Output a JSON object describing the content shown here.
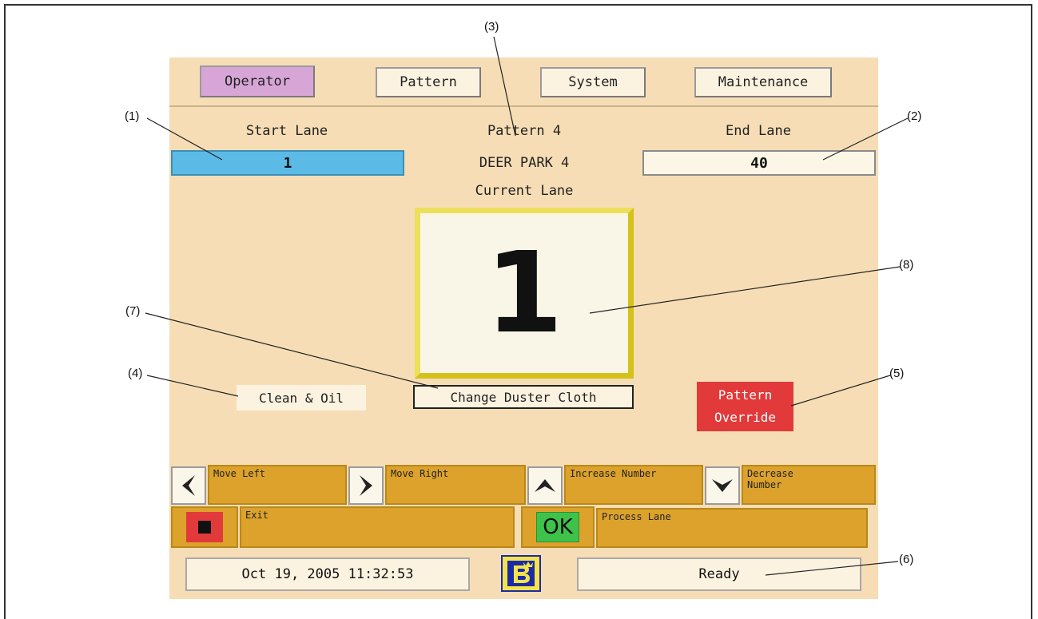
{
  "tabs": [
    {
      "label": "Operator"
    },
    {
      "label": "Pattern"
    },
    {
      "label": "System"
    },
    {
      "label": "Maintenance"
    }
  ],
  "start_lane": {
    "label": "Start Lane",
    "value": "1"
  },
  "end_lane": {
    "label": "End Lane",
    "value": "40"
  },
  "pattern": {
    "label": "Pattern 4",
    "name": "DEER PARK 4"
  },
  "current_lane": {
    "label": "Current Lane",
    "value": "1"
  },
  "buttons": {
    "clean_oil": "Clean & Oil",
    "change_duster": "Change Duster Cloth",
    "pattern_override_line1": "Pattern",
    "pattern_override_line2": "Override"
  },
  "hints": {
    "move_left": "Move Left",
    "move_right": "Move Right",
    "increase": "Increase Number",
    "decrease_line1": "Decrease",
    "decrease_line2": "Number",
    "exit": "Exit",
    "ok": "OK",
    "process": "Process Lane"
  },
  "status": {
    "datetime": "Oct 19, 2005 11:32:53",
    "state": "Ready"
  },
  "callouts": [
    "(1)",
    "(2)",
    "(3)",
    "(4)",
    "(5)",
    "(6)",
    "(7)",
    "(8)"
  ],
  "colors": {
    "screen_bg": "#f6ddb5",
    "active_tab": "#d7a6d7",
    "start_lane_bg": "#5cbbe6",
    "override_red": "#e23a3a",
    "hint_bar": "#dca22c",
    "ok_green": "#3ec24a",
    "frame_yellow": "#d4c21a"
  }
}
